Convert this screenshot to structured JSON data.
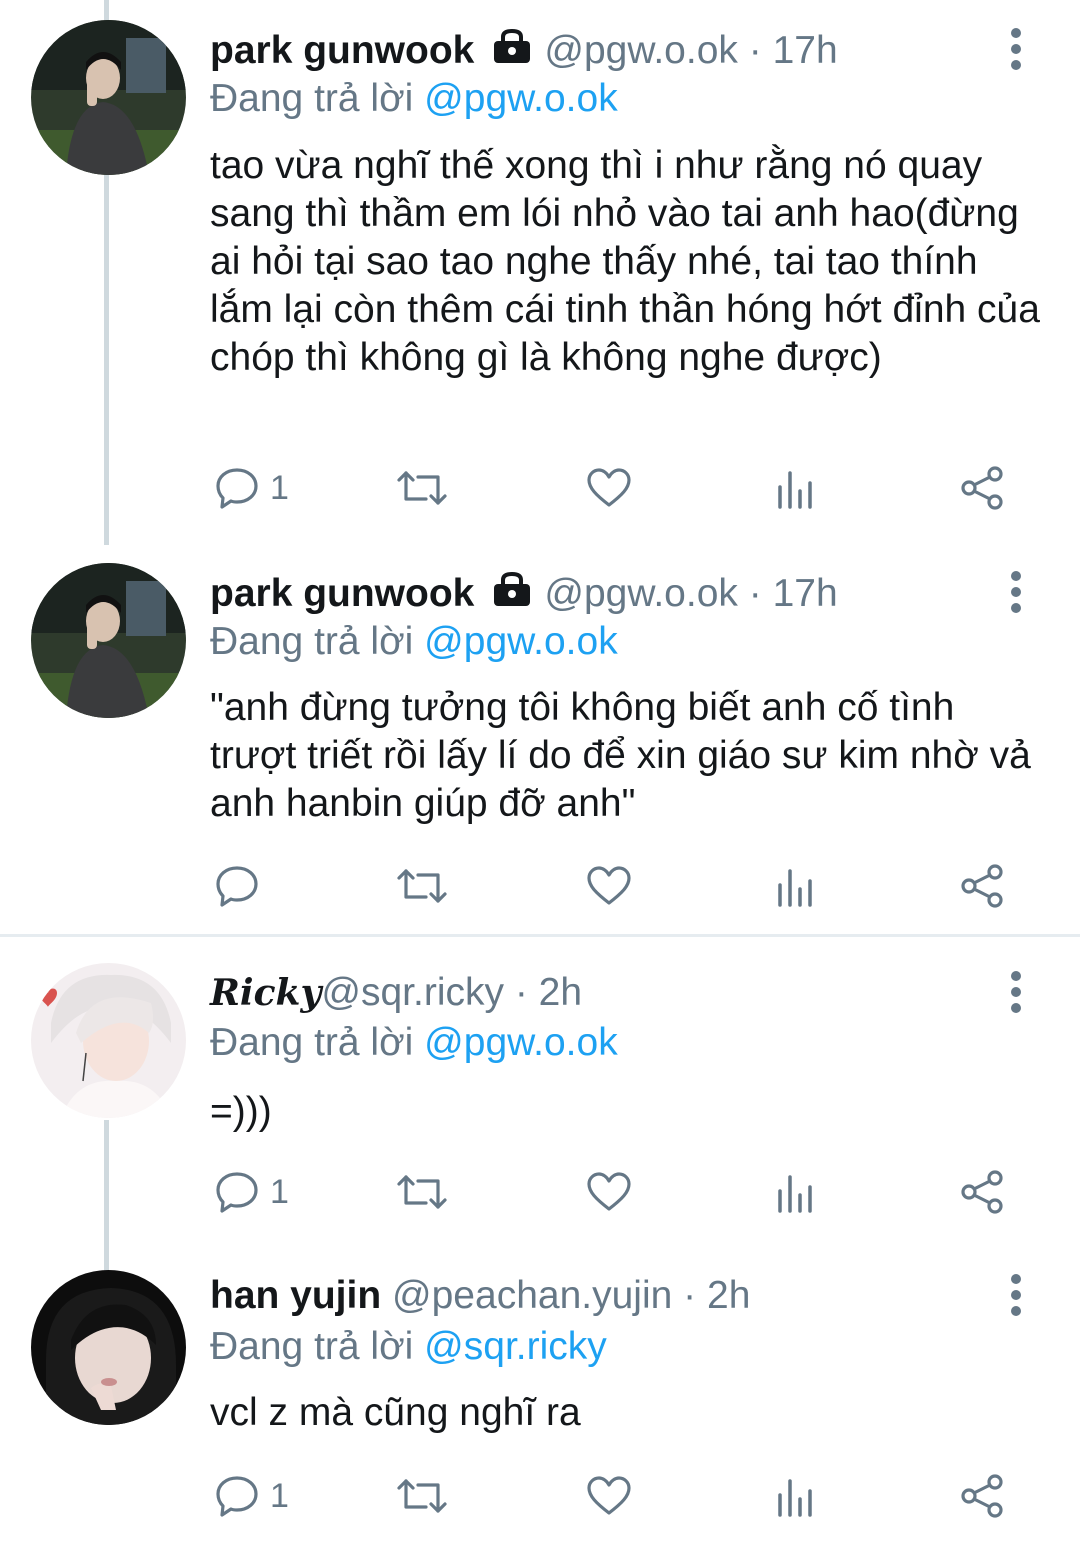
{
  "tweets": [
    {
      "name": "park gunwook",
      "locked": true,
      "handle": "@pgw.o.ok",
      "sep": "·",
      "time": "17h",
      "replying_prefix": "Đang trả lời",
      "replying_to": "@pgw.o.ok",
      "text": "tao vừa nghĩ thế xong thì i như rằng nó quay sang thì thầm em lói nhỏ vào tai anh hao(đừng ai hỏi tại sao tao nghe thấy nhé, tai tao thính lắm lại còn thêm cái tinh thần hóng hớt đỉnh của chóp thì không gì là không nghe được)",
      "reply_count": "1"
    },
    {
      "name": "park gunwook",
      "locked": true,
      "handle": "@pgw.o.ok",
      "sep": "·",
      "time": "17h",
      "replying_prefix": "Đang trả lời",
      "replying_to": "@pgw.o.ok",
      "text": "\"anh đừng tưởng tôi không biết anh cố tình trượt triết rồi lấy lí do để xin giáo sư kim nhờ vả anh hanbin giúp đỡ anh\"",
      "reply_count": ""
    },
    {
      "name": "Ricky",
      "locked": false,
      "handle": "@sqr.ricky",
      "sep": "·",
      "time": "2h",
      "replying_prefix": "Đang trả lời",
      "replying_to": "@pgw.o.ok",
      "text": "=)))",
      "reply_count": "1"
    },
    {
      "name": "han yujin",
      "locked": false,
      "handle": "@peachan.yujin",
      "sep": "·",
      "time": "2h",
      "replying_prefix": "Đang trả lời",
      "replying_to": "@sqr.ricky",
      "text": "vcl z mà cũng nghĩ ra",
      "reply_count": "1"
    }
  ],
  "icons": {
    "reply": "reply-icon",
    "retweet": "retweet-icon",
    "like": "heart-icon",
    "analytics": "analytics-icon",
    "share": "share-icon",
    "more": "more-vertical-icon",
    "lock": "lock-icon"
  },
  "colors": {
    "text": "#14171a",
    "secondary": "#657786",
    "link": "#1da1f2",
    "thread_line": "#cfd9de",
    "divider": "#e6ecf0"
  }
}
